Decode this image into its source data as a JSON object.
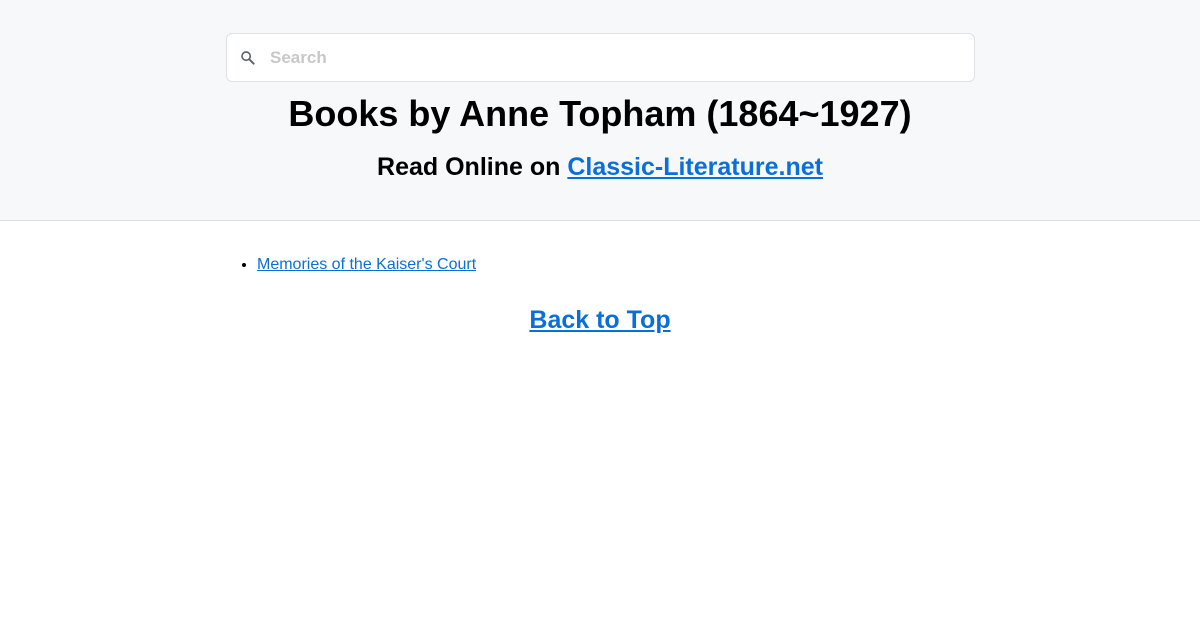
{
  "search": {
    "placeholder": "Search",
    "value": ""
  },
  "header": {
    "title": "Books by Anne Topham (1864~1927)",
    "subtitle_prefix": "Read Online on ",
    "site_link": "Classic-Literature.net"
  },
  "books": [
    {
      "title": "Memories of the Kaiser's Court"
    }
  ],
  "footer": {
    "back_to_top": "Back to Top"
  },
  "colors": {
    "link": "#0a6fd8",
    "header_bg": "#f7f8fa",
    "placeholder": "#c8c8c8"
  }
}
